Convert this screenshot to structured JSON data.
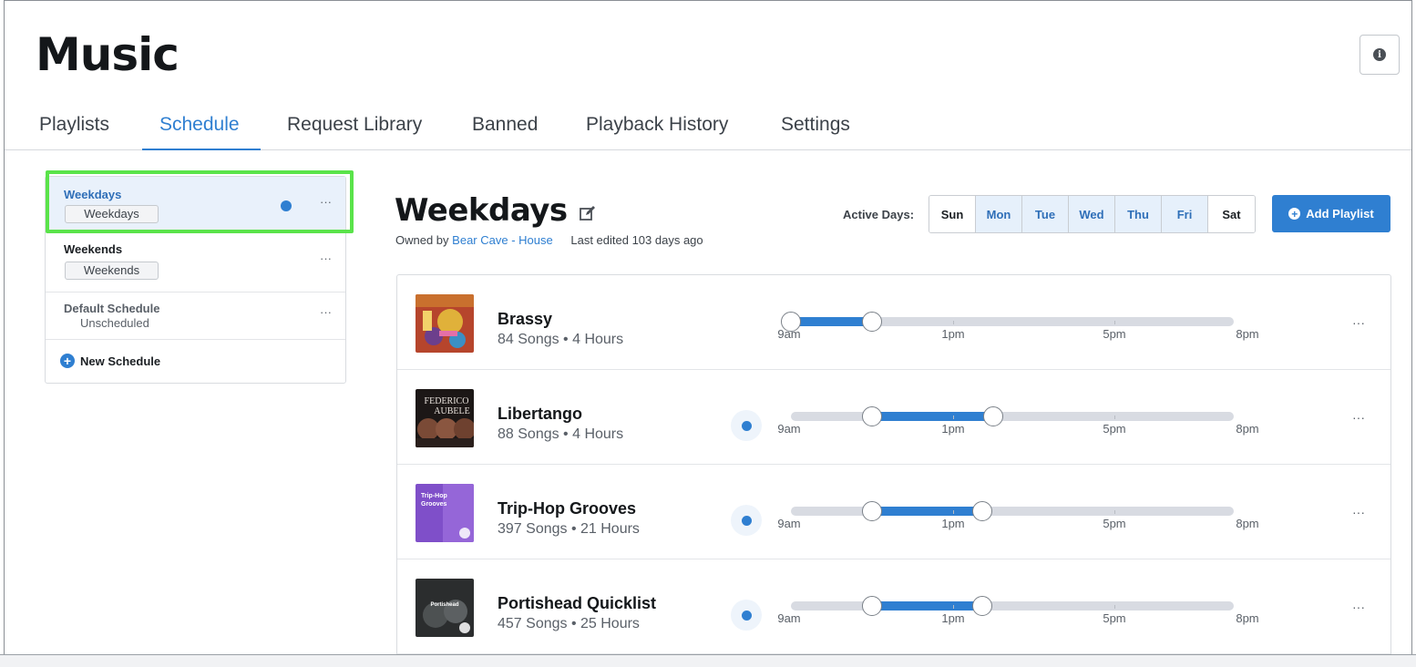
{
  "app": {
    "title": "Music"
  },
  "tabs": [
    {
      "label": "Playlists"
    },
    {
      "label": "Schedule",
      "active": true
    },
    {
      "label": "Request Library"
    },
    {
      "label": "Banned"
    },
    {
      "label": "Playback History"
    },
    {
      "label": "Settings"
    }
  ],
  "schedules": [
    {
      "name": "Weekdays",
      "tag": "Weekdays",
      "selected": true,
      "active": true
    },
    {
      "name": "Weekends",
      "tag": "Weekends"
    },
    {
      "name": "Default Schedule",
      "sub": "Unscheduled"
    }
  ],
  "new_schedule_label": "New Schedule",
  "more_label": "···",
  "header": {
    "title": "Weekdays",
    "owned_by_prefix": "Owned by",
    "owner": "Bear Cave - House",
    "last_edited": "Last edited 103 days ago",
    "active_days_label": "Active Days:",
    "add_playlist_label": "Add Playlist"
  },
  "days": [
    {
      "label": "Sun",
      "active": false
    },
    {
      "label": "Mon",
      "active": true
    },
    {
      "label": "Tue",
      "active": true
    },
    {
      "label": "Wed",
      "active": true
    },
    {
      "label": "Thu",
      "active": true
    },
    {
      "label": "Fri",
      "active": true
    },
    {
      "label": "Sat",
      "active": false
    }
  ],
  "time_labels": [
    "9am",
    "1pm",
    "5pm",
    "8pm"
  ],
  "playlists": [
    {
      "name": "Brassy",
      "meta": "84 Songs • 4 Hours",
      "live": false,
      "start": "9am",
      "end": "11am"
    },
    {
      "name": "Libertango",
      "meta": "88 Songs • 4 Hours",
      "live": true,
      "start": "11am",
      "end": "2pm"
    },
    {
      "name": "Trip-Hop Grooves",
      "meta": "397 Songs • 21 Hours",
      "live": true,
      "start": "11am",
      "end": "2pm"
    },
    {
      "name": "Portishead Quicklist",
      "meta": "457 Songs • 25 Hours",
      "live": true,
      "start": "11am",
      "end": "2pm"
    }
  ],
  "colors": {
    "accent": "#2f7fd1",
    "highlight": "#5ae34a"
  }
}
